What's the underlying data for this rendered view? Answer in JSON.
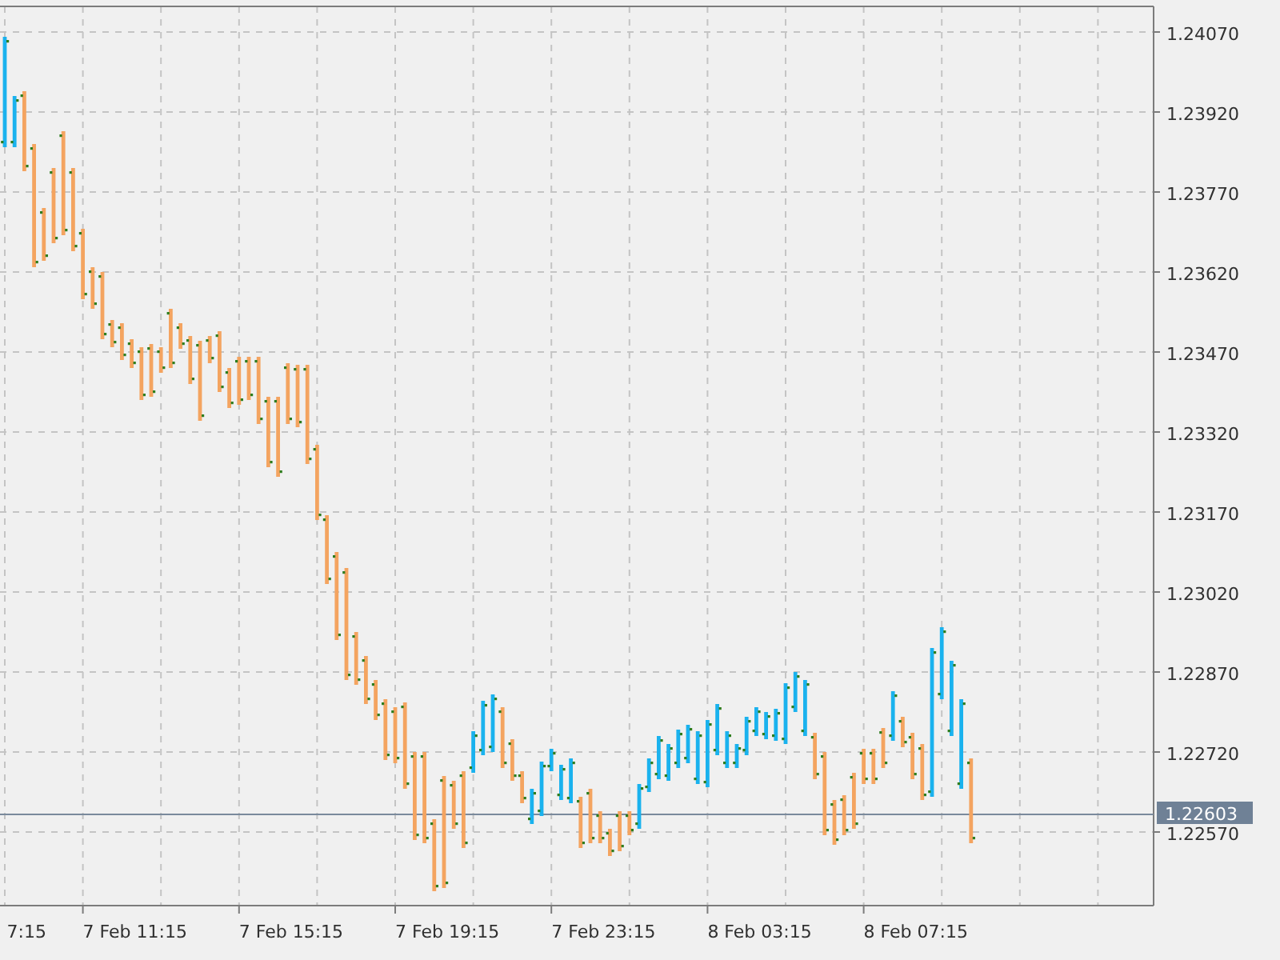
{
  "chart": {
    "current_price": "1.22603",
    "price_axis": [
      "1.24070",
      "1.23920",
      "1.23770",
      "1.23620",
      "1.23470",
      "1.23320",
      "1.23170",
      "1.23020",
      "1.22870",
      "1.22720",
      "1.22570"
    ],
    "time_axis": [
      {
        "label": "7:15",
        "kind": "cut"
      },
      {
        "label": "7 Feb 11:15",
        "kind": "tick"
      },
      {
        "label": "7 Feb 15:15",
        "kind": "tick"
      },
      {
        "label": "7 Feb 19:15",
        "kind": "tick"
      },
      {
        "label": "7 Feb 23:15",
        "kind": "tick"
      },
      {
        "label": "8 Feb 03:15",
        "kind": "tick"
      },
      {
        "label": "8 Feb 07:15",
        "kind": "tick"
      }
    ]
  }
}
